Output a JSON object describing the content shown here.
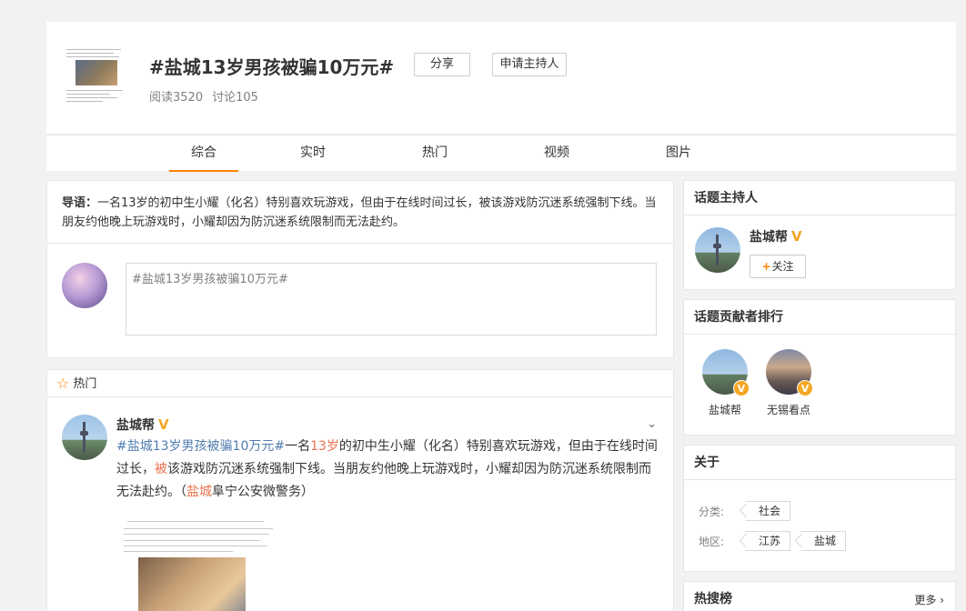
{
  "topic": {
    "title": "#盐城13岁男孩被骗10万元#",
    "share_label": "分享",
    "apply_host_label": "申请主持人",
    "reads": "阅读3520",
    "discussions": "讨论105"
  },
  "tabs": [
    {
      "label": "综合",
      "active": true
    },
    {
      "label": "实时",
      "active": false
    },
    {
      "label": "热门",
      "active": false
    },
    {
      "label": "视频",
      "active": false
    },
    {
      "label": "图片",
      "active": false
    }
  ],
  "guide": {
    "label": "导语：",
    "text": "一名13岁的初中生小耀（化名）特别喜欢玩游戏，但由于在线时间过长，被该游戏防沉迷系统强制下线。当朋友约他晚上玩游戏时，小耀却因为防沉迷系统限制而无法赴约。"
  },
  "composer": {
    "prefill": "#盐城13岁男孩被骗10万元#"
  },
  "feed": {
    "section_label": "热门",
    "post": {
      "author": "盐城帮",
      "verified_glyph": "V",
      "hashtag": "#盐城13岁男孩被骗10万元#",
      "t1": "一名",
      "hl1": "13岁",
      "t2": "的初中生小耀（化名）特别喜欢玩游戏，但由于在线时间过长，",
      "hl2": "被",
      "t3": "该游戏防沉迷系统强制下线。当朋友约他晚上玩游戏时，小耀却因为防沉迷系统限制而无法赴约。（",
      "hl3": "盐城",
      "t4": "阜宁公安微警务）"
    }
  },
  "sidebar": {
    "host_title": "话题主持人",
    "host_name": "盐城帮",
    "verified_glyph": "V",
    "follow_plus": "+",
    "follow_label": "关注",
    "rank_title": "话题贡献者排行",
    "contributors": [
      {
        "name": "盐城帮",
        "badge": "V"
      },
      {
        "name": "无锡看点",
        "badge": "V"
      }
    ],
    "about_title": "关于",
    "category_label": "分类:",
    "categories": [
      "社会"
    ],
    "region_label": "地区:",
    "regions": [
      "江苏",
      "盐城"
    ],
    "hot_title": "热搜榜",
    "more_label": "更多",
    "more_glyph": "›"
  },
  "colors": {
    "accent": "#ff8200",
    "link_blue": "#507daf",
    "link_red": "#eb7350",
    "verified": "#f5a623"
  }
}
